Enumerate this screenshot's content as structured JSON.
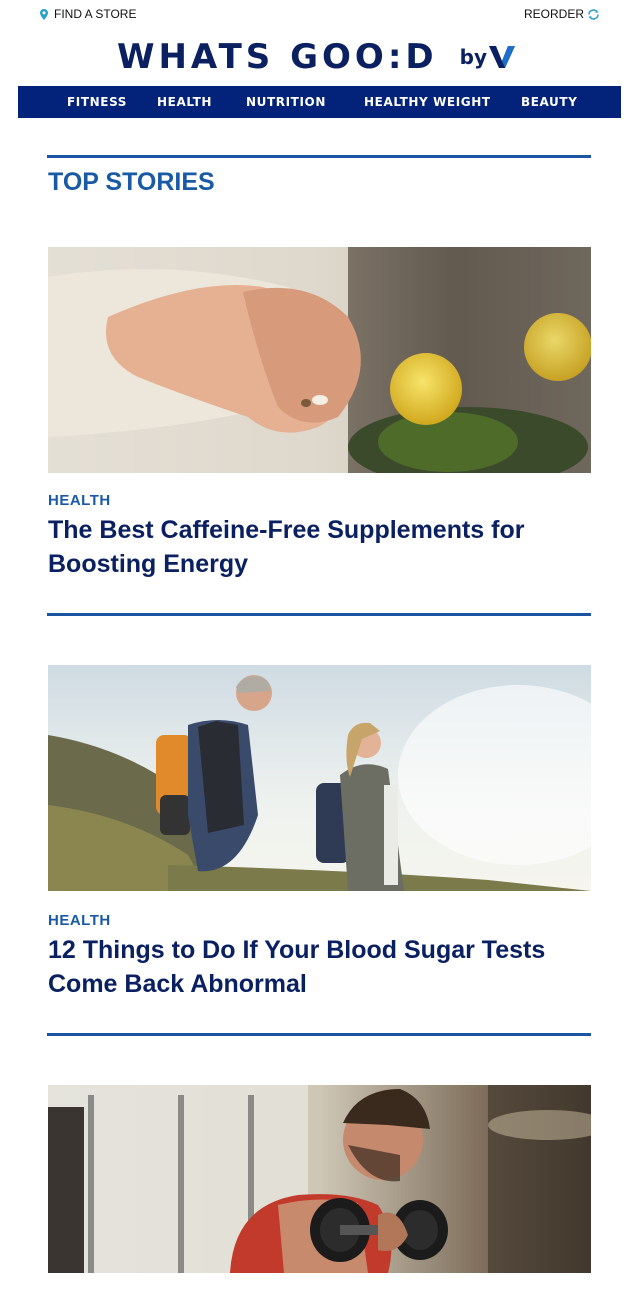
{
  "header": {
    "find_store": "FIND A STORE",
    "reorder": "REORDER",
    "logo_main": "WHATS GOO:D",
    "logo_by": "by",
    "logo_mark": "V"
  },
  "nav": {
    "items": [
      {
        "label": "FITNESS"
      },
      {
        "label": "HEALTH"
      },
      {
        "label": "NUTRITION"
      },
      {
        "label": "HEALTHY WEIGHT"
      },
      {
        "label": "BEAUTY"
      }
    ]
  },
  "section_title": "TOP STORIES",
  "stories": [
    {
      "category": "HEALTH",
      "headline": "The Best Caffeine-Free Supplements for Boosting Energy"
    },
    {
      "category": "HEALTH",
      "headline": "12 Things to Do If Your Blood Sugar Tests Come Back Abnormal"
    },
    {
      "category": "",
      "headline": ""
    }
  ],
  "colors": {
    "nav_bg": "#03237a",
    "brand_navy": "#0a2060",
    "accent_blue": "#1a5aa5",
    "icon_teal": "#2a9fc9"
  }
}
